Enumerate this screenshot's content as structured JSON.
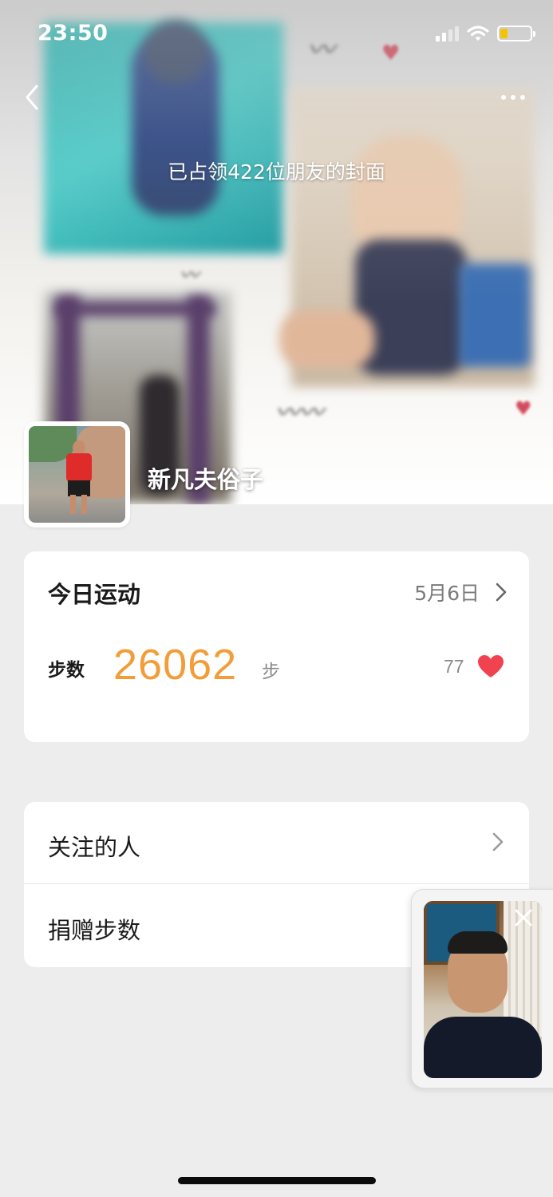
{
  "status_bar": {
    "time": "23:50"
  },
  "cover": {
    "caption": "已占领422位朋友的封面"
  },
  "profile": {
    "nickname": "新凡夫俗子"
  },
  "sport_card": {
    "title": "今日运动",
    "date": "5月6日",
    "steps_label": "步数",
    "steps_value": "26062",
    "steps_unit": "步",
    "likes": "77"
  },
  "list": {
    "items": [
      {
        "label": "关注的人"
      },
      {
        "label": "捐赠步数"
      }
    ]
  },
  "colors": {
    "steps_accent": "#f29d38",
    "like_heart": "#f0434f",
    "page_bg": "#ededed"
  },
  "icons": [
    "back-icon",
    "more-icon",
    "chevron-right-icon",
    "heart-icon",
    "close-icon"
  ]
}
